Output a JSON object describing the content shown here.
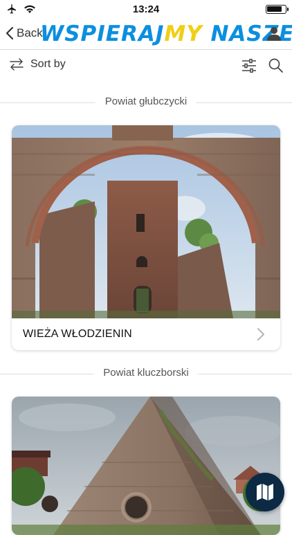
{
  "status_bar": {
    "time": "13:24",
    "icons": [
      "airplane-icon",
      "wifi-icon",
      "battery-icon"
    ],
    "battery_level": 0.85
  },
  "nav": {
    "back_label": "Back",
    "brand_part1": "WSPIERAJ",
    "brand_part2": "MY",
    "brand_part3": " NASZE",
    "user_icon": "user-icon"
  },
  "toolbar": {
    "sort_label": "Sort by",
    "sort_icon": "swap-arrows-icon",
    "filter_icon": "sliders-icon",
    "search_icon": "search-icon"
  },
  "sections": [
    {
      "title": "Powiat głubczycki",
      "items": [
        {
          "title": "WIEŻA WŁODZIENIN",
          "image": "photo of a ruined brick church tower seen through an arch"
        }
      ]
    },
    {
      "title": "Powiat kluczborski",
      "items": [
        {
          "title": "",
          "image": "photo of a stone pyramid tomb"
        }
      ]
    }
  ],
  "map_button": {
    "icon": "map-icon"
  },
  "colors": {
    "brand_blue": "#0b8fe0",
    "brand_yellow": "#f0cf14",
    "fab_bg": "#0d2a45"
  }
}
